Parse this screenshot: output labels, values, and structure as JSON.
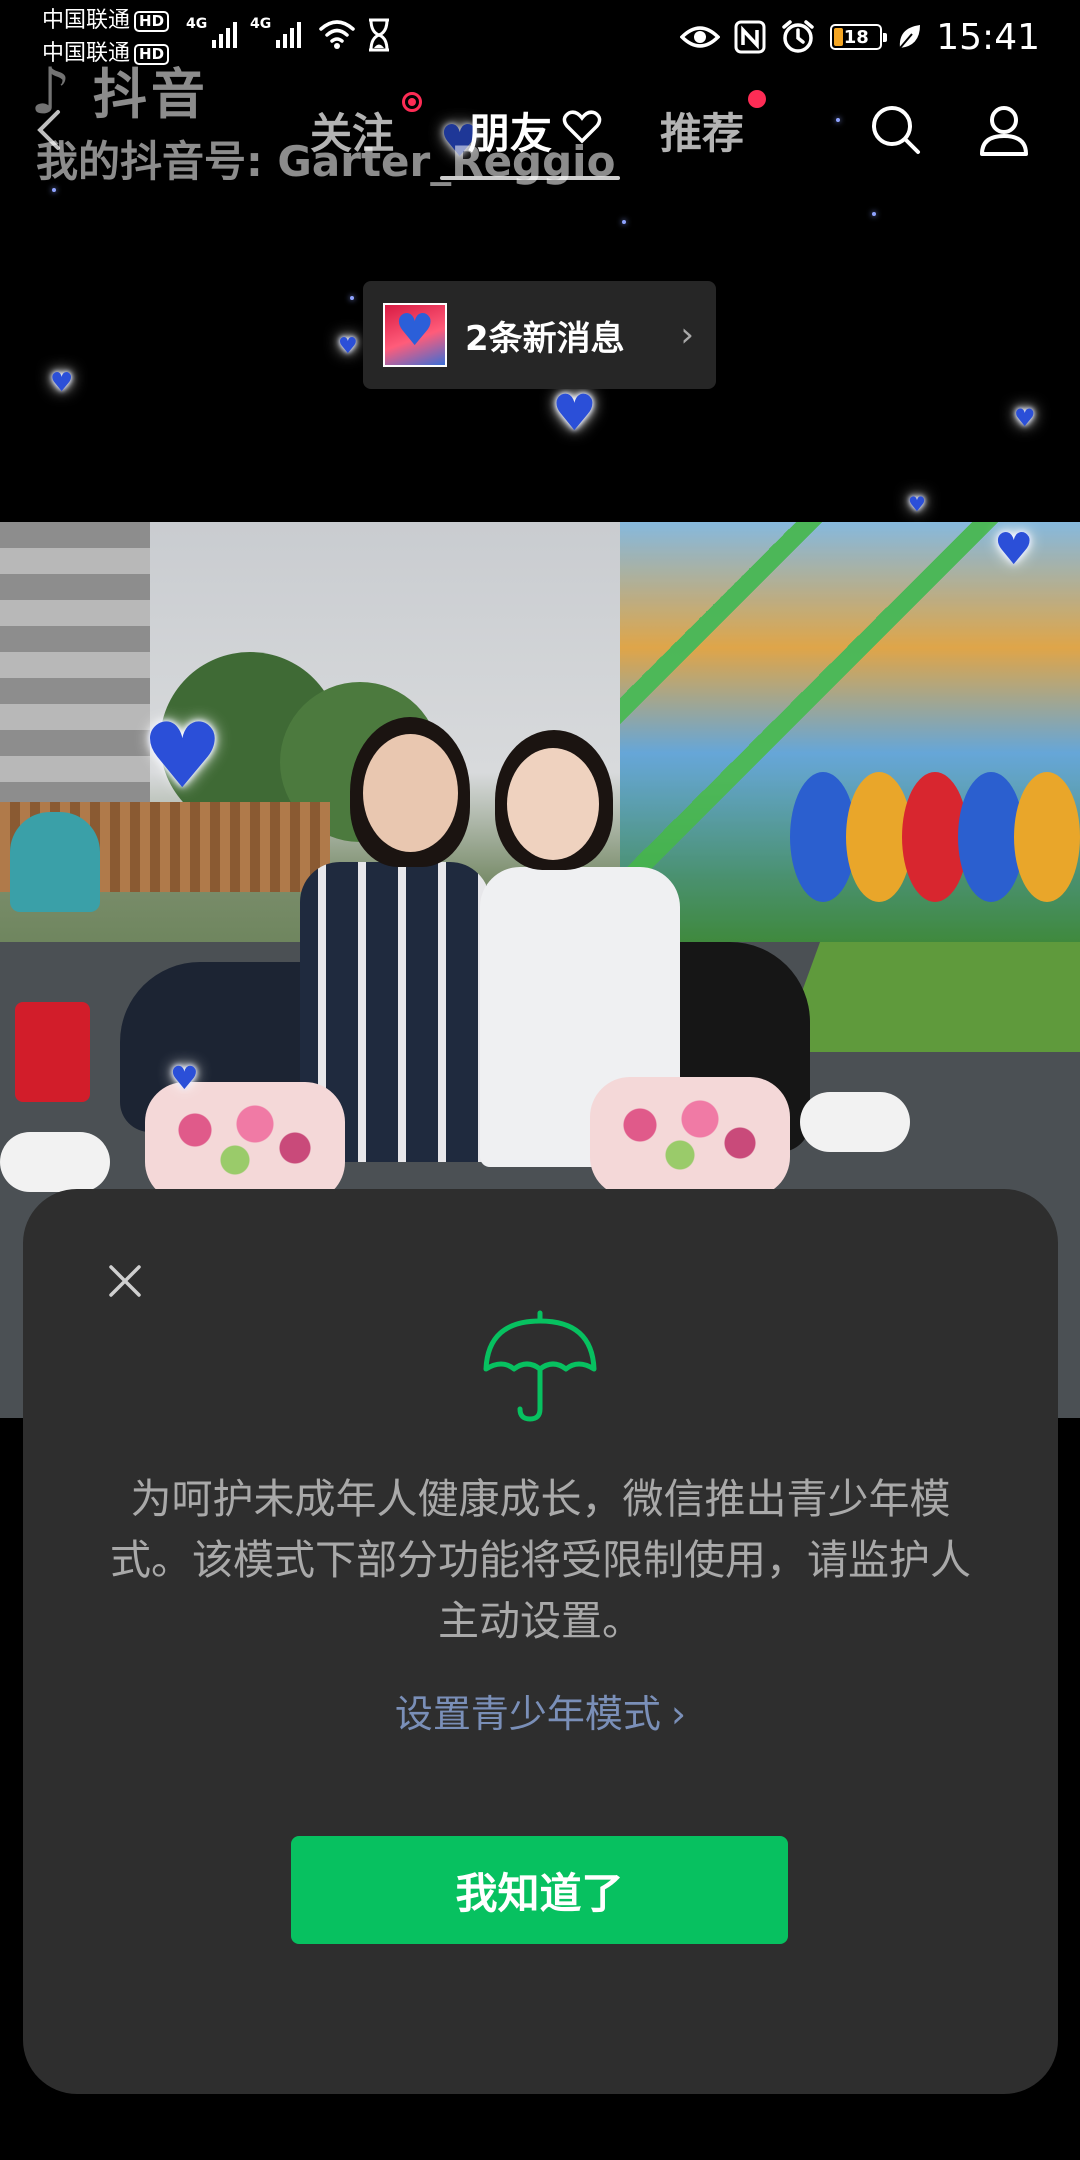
{
  "status_bar": {
    "carrier_1": "中国联通",
    "carrier_2": "中国联通",
    "hd_badge": "HD",
    "network_1": "4G",
    "network_2": "4G",
    "battery_level": "18",
    "battery_fraction": 0.18,
    "time": "15:41",
    "icons": [
      "eye-icon",
      "nfc-icon",
      "alarm-icon",
      "leaf-icon",
      "wifi-icon",
      "hourglass-icon"
    ]
  },
  "header": {
    "watermark_logo": "抖音",
    "watermark_id": "我的抖音号: Garter_Reggio",
    "tabs": [
      {
        "label": "关注",
        "badge": "live-dot"
      },
      {
        "label": "朋友",
        "active": true
      },
      {
        "label": "推荐",
        "badge": "red-dot"
      }
    ],
    "icons": [
      "search-icon",
      "profile-icon"
    ]
  },
  "notification": {
    "text": "2条新消息",
    "chevron": "›"
  },
  "dialog": {
    "description": "为呵护未成年人健康成长，微信推出青少年模式。该模式下部分功能将受限制使用，请监护人主动设置。",
    "link_label": "设置青少年模式",
    "link_chevron": "›",
    "button_label": "我知道了",
    "accent_color": "#07c160",
    "icon": "umbrella-icon"
  }
}
